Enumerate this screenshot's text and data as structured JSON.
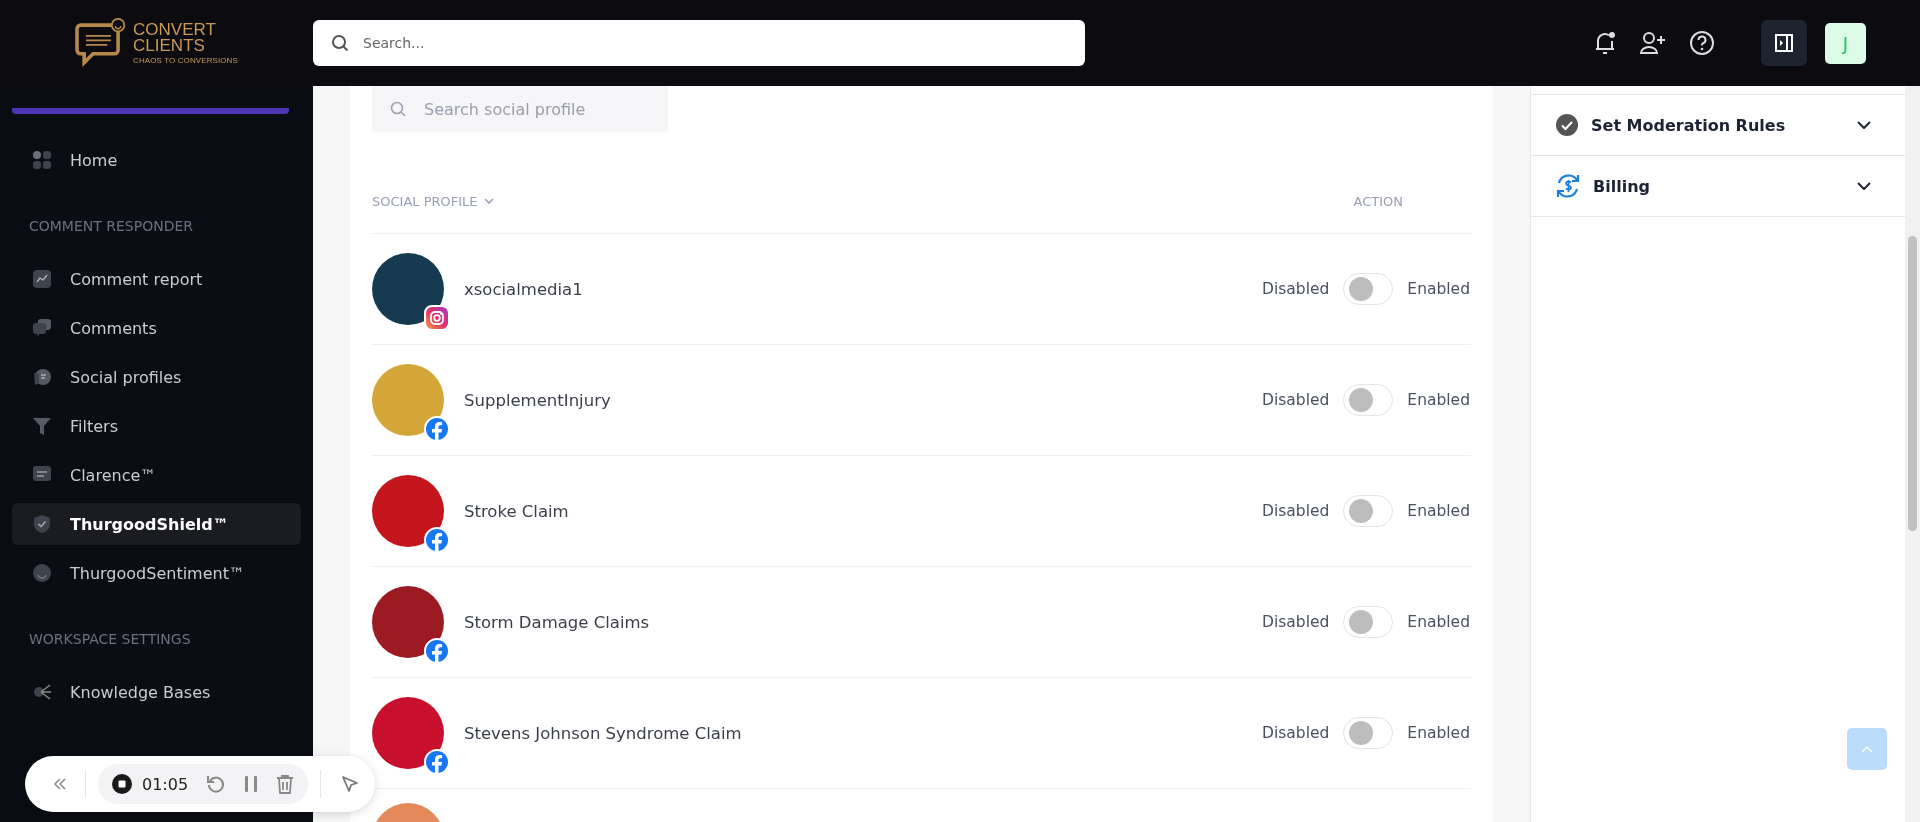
{
  "logo": {
    "name_line_1": "CONVERT",
    "name_line_2": "CLIENTS",
    "tagline": "CHAOS TO CONVERSIONS"
  },
  "search": {
    "placeholder": "Search..."
  },
  "user": {
    "initial": "J"
  },
  "sidebar": {
    "items": [
      {
        "kind": "item",
        "label": "Home",
        "selected": false
      },
      {
        "kind": "section",
        "label": "COMMENT RESPONDER"
      },
      {
        "kind": "item",
        "label": "Comment report",
        "selected": false
      },
      {
        "kind": "item",
        "label": "Comments",
        "selected": false
      },
      {
        "kind": "item",
        "label": "Social profiles",
        "selected": false
      },
      {
        "kind": "item",
        "label": "Filters",
        "selected": false
      },
      {
        "kind": "item",
        "label": "Clarence™",
        "selected": false
      },
      {
        "kind": "item",
        "label": "ThurgoodShield™",
        "selected": true
      },
      {
        "kind": "item",
        "label": "ThurgoodSentiment™",
        "selected": false
      },
      {
        "kind": "section",
        "label": "WORKSPACE SETTINGS"
      },
      {
        "kind": "item",
        "label": "Knowledge Bases",
        "selected": false
      }
    ]
  },
  "profiles": {
    "search_placeholder": "Search social profile",
    "columns": [
      "SOCIAL PROFILE",
      "ACTION"
    ],
    "rows": [
      {
        "name": "xsocialmedia1",
        "color": "#163a4f",
        "kind": "instagram",
        "off_label": "Disabled",
        "on_label": "Enabled",
        "on": false
      },
      {
        "name": "SupplementInjury",
        "color": "#d4a537",
        "kind": "facebook",
        "off_label": "Disabled",
        "on_label": "Enabled",
        "on": false
      },
      {
        "name": "Stroke Claim",
        "color": "#c4161c",
        "kind": "facebook",
        "off_label": "Disabled",
        "on_label": "Enabled",
        "on": false
      },
      {
        "name": "Storm Damage Claims",
        "color": "#9c1b23",
        "kind": "facebook",
        "off_label": "Disabled",
        "on_label": "Enabled",
        "on": false
      },
      {
        "name": "Stevens Johnson Syndrome Claim",
        "color": "#c8102e",
        "kind": "facebook",
        "off_label": "Disabled",
        "on_label": "Enabled",
        "on": false
      }
    ]
  },
  "settings_panel": [
    {
      "label": "Set Moderation Rules",
      "expanded": false
    },
    {
      "label": "Billing",
      "expanded": false
    }
  ],
  "recorder": {
    "time": "01:05"
  }
}
